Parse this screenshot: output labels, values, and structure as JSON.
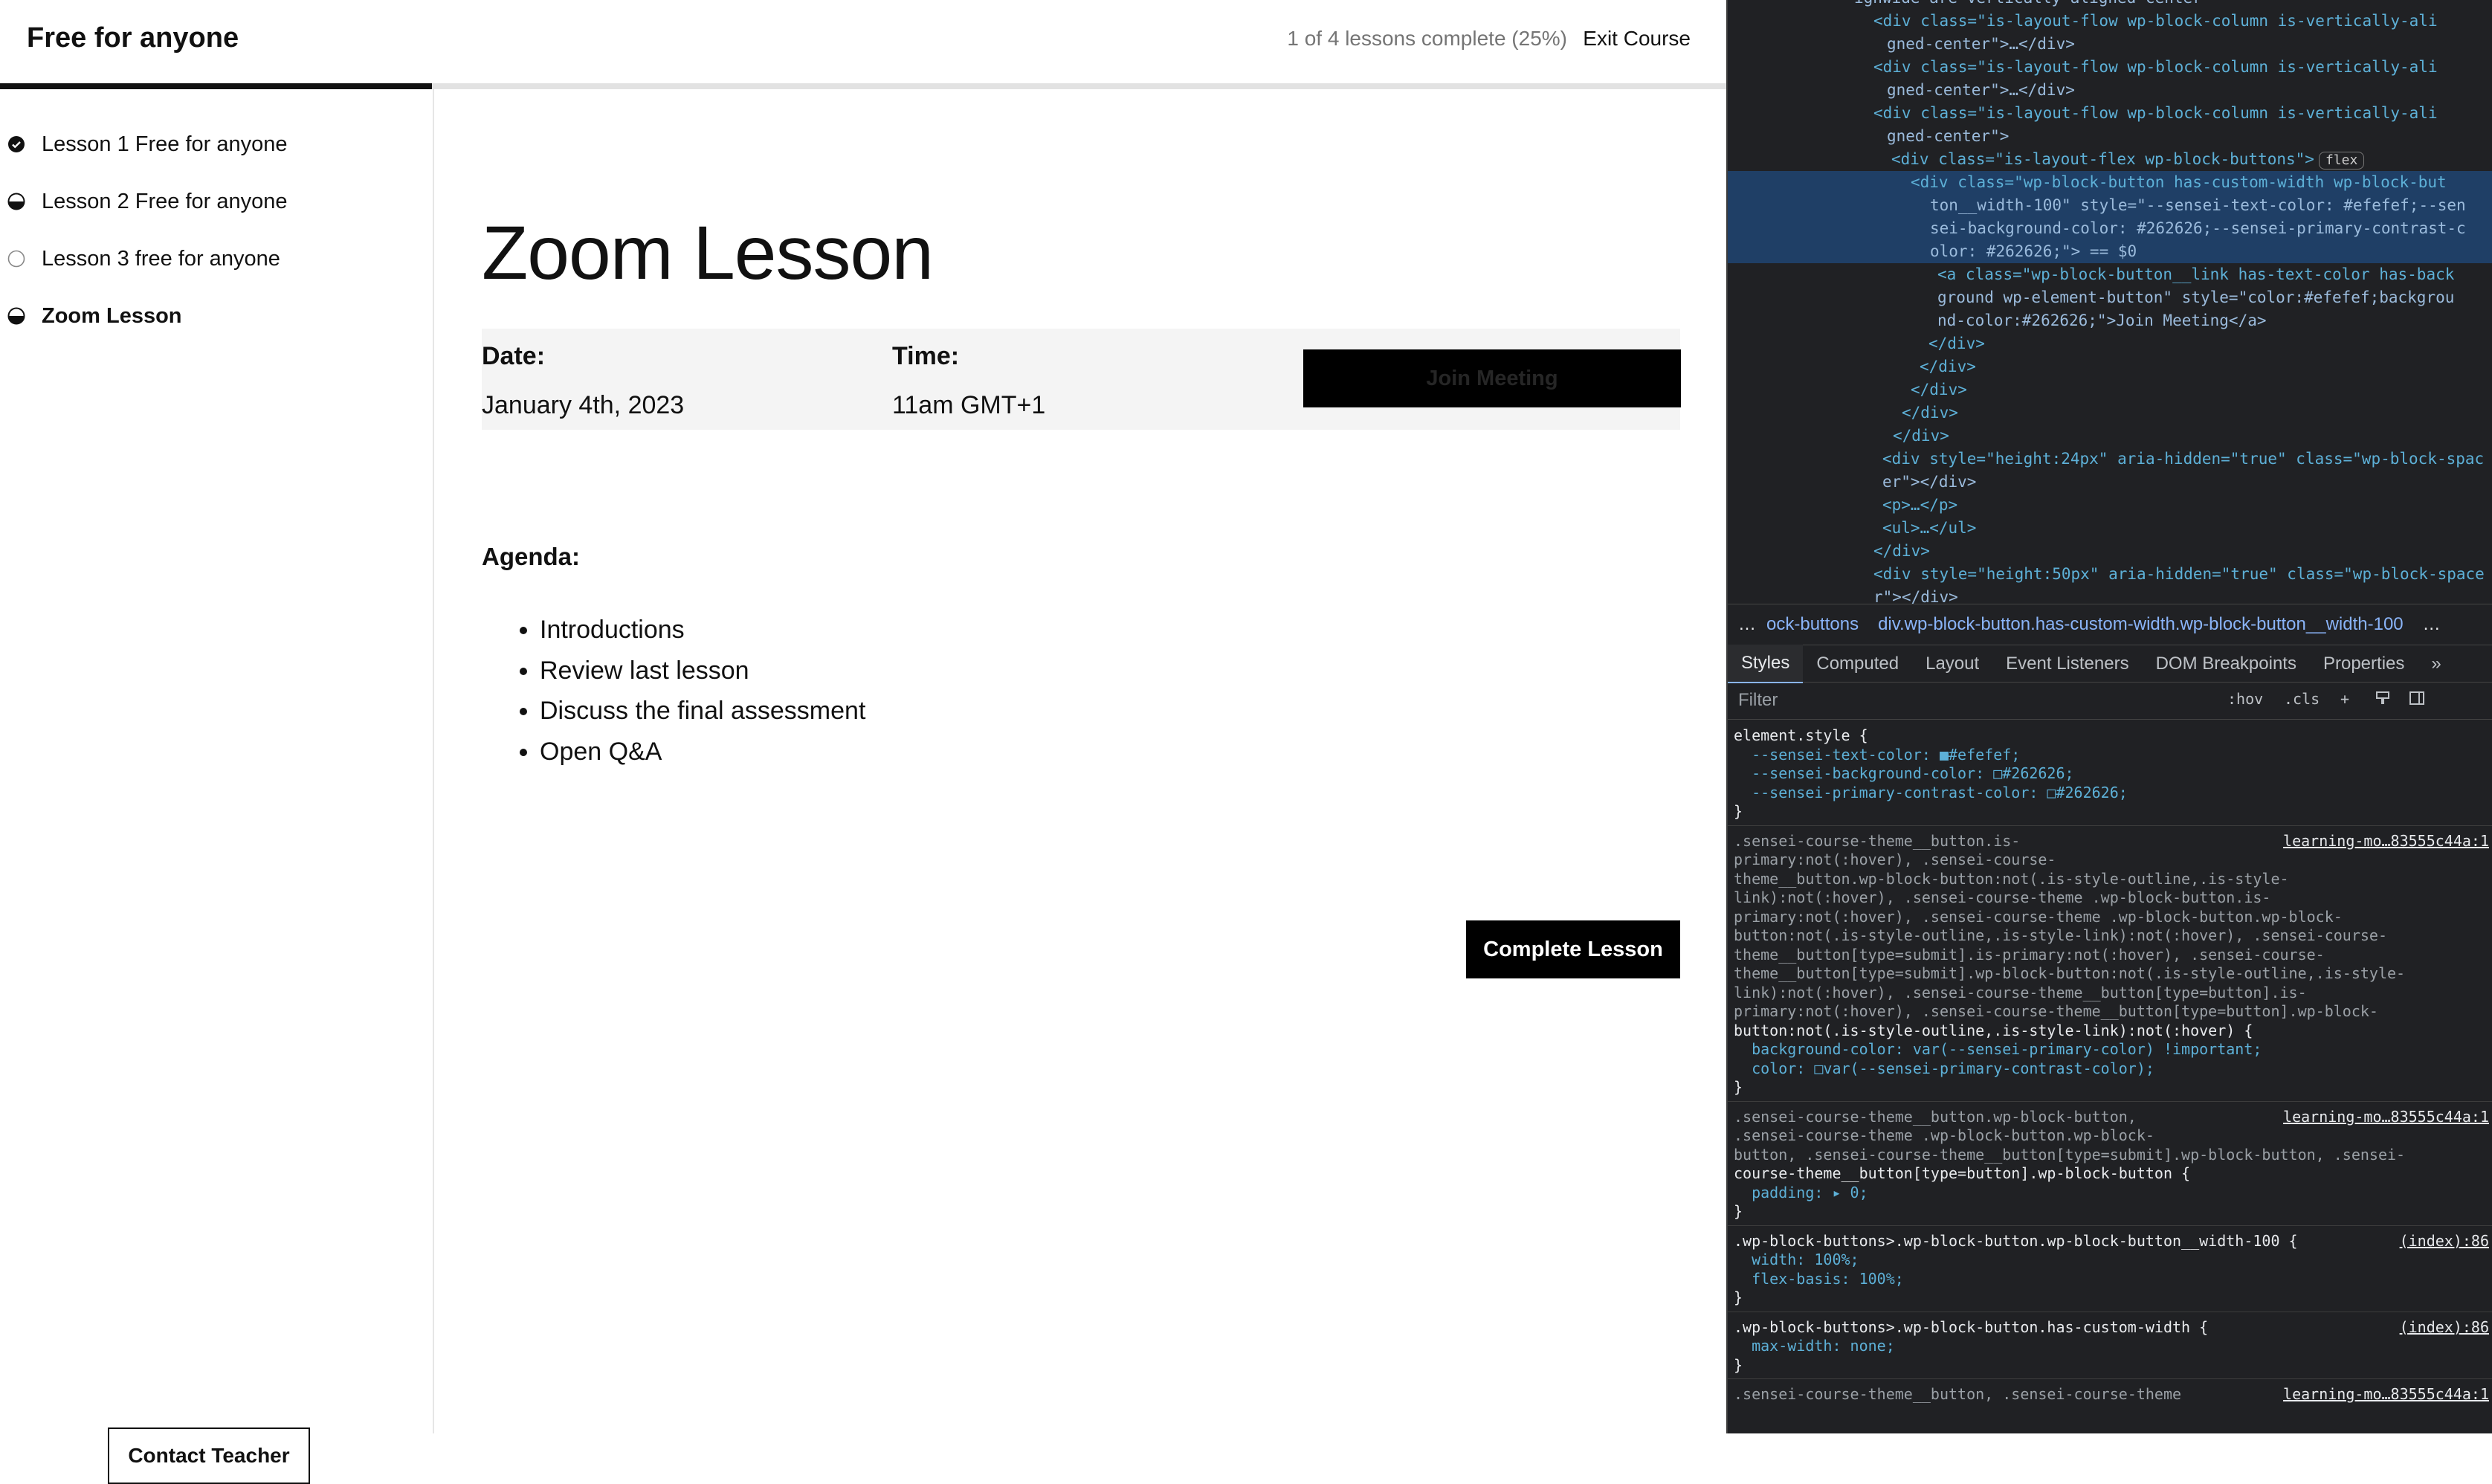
{
  "header": {
    "course_title": "Free for anyone",
    "progress_text": "1 of 4 lessons complete (25%)",
    "progress_fraction": 0.25,
    "exit_label": "Exit Course"
  },
  "sidebar": {
    "lessons": [
      {
        "label": "Lesson 1 Free for anyone",
        "status": "complete"
      },
      {
        "label": "Lesson 2 Free for anyone",
        "status": "in-progress"
      },
      {
        "label": "Lesson 3 free for anyone",
        "status": "not-started"
      },
      {
        "label": "Zoom Lesson",
        "status": "in-progress"
      }
    ],
    "contact_label": "Contact Teacher"
  },
  "lesson": {
    "title": "Zoom Lesson",
    "date_label": "Date:",
    "date_value": "January 4th, 2023",
    "time_label": "Time:",
    "time_value": "11am GMT+1",
    "join_label": "Join Meeting",
    "agenda_title": "Agenda:",
    "agenda_items": [
      "Introductions",
      "Review last lesson",
      "Discuss the final assessment",
      "Open Q&A"
    ],
    "complete_label": "Complete Lesson"
  },
  "devtools": {
    "dom_lines": [
      "ighwide are vertically aligned center",
      "<div class=\"is-layout-flow wp-block-column is-vertically-ali",
      "gned-center\">…</div>",
      "<div class=\"is-layout-flow wp-block-column is-vertically-ali",
      "gned-center\">…</div>",
      "<div class=\"is-layout-flow wp-block-column is-vertically-ali",
      "gned-center\">",
      "<div class=\"is-layout-flex wp-block-buttons\">",
      "<div class=\"wp-block-button has-custom-width wp-block-but",
      "ton__width-100\" style=\"--sensei-text-color: #efefef;--sen",
      "sei-background-color: #262626;--sensei-primary-contrast-c",
      "olor: #262626;\"> == $0",
      "<a class=\"wp-block-button__link has-text-color has-back",
      "ground wp-element-button\" style=\"color:#efefef;backgrou",
      "nd-color:#262626;\">Join Meeting</a>",
      "</div>",
      "</div>",
      "</div>",
      "</div>",
      "</div>",
      "<div style=\"height:24px\" aria-hidden=\"true\" class=\"wp-block-spac",
      "er\"></div>",
      "<p>…</p>",
      "<ul>…</ul>",
      "</div>",
      "<div style=\"height:50px\" aria-hidden=\"true\" class=\"wp-block-space",
      "r\"></div>"
    ],
    "flex_badge": "flex",
    "breadcrumb": [
      "…",
      "ock-buttons",
      "div.wp-block-button.has-custom-width.wp-block-button__width-100",
      "…"
    ],
    "tabs": [
      "Styles",
      "Computed",
      "Layout",
      "Event Listeners",
      "DOM Breakpoints",
      "Properties",
      "»"
    ],
    "filter_placeholder": "Filter",
    "filter_controls": [
      ":hov",
      ".cls",
      "+"
    ],
    "style_lines": [
      "element.style {",
      "  --sensei-text-color: ■#efefef;",
      "  --sensei-background-color: □#262626;",
      "  --sensei-primary-contrast-color: □#262626;",
      "}",
      ".sensei-course-theme__button.is-",
      "primary:not(:hover), .sensei-course-",
      "theme__button.wp-block-button:not(.is-style-outline,.is-style-",
      "link):not(:hover), .sensei-course-theme .wp-block-button.is-",
      "primary:not(:hover), .sensei-course-theme .wp-block-button.wp-block-",
      "button:not(.is-style-outline,.is-style-link):not(:hover), .sensei-course-",
      "theme__button[type=submit].is-primary:not(:hover), .sensei-course-",
      "theme__button[type=submit].wp-block-button:not(.is-style-outline,.is-style-",
      "link):not(:hover), .sensei-course-theme__button[type=button].is-",
      "primary:not(:hover), .sensei-course-theme__button[type=button].wp-block-",
      "button:not(.is-style-outline,.is-style-link):not(:hover) {",
      "  background-color: var(--sensei-primary-color) !important;",
      "  color: □var(--sensei-primary-contrast-color);",
      "}",
      ".sensei-course-theme__button.wp-block-button,",
      ".sensei-course-theme .wp-block-button.wp-block-",
      "button, .sensei-course-theme__button[type=submit].wp-block-button, .sensei-",
      "course-theme__button[type=button].wp-block-button {",
      "  padding: ▸ 0;",
      "}",
      ".wp-block-buttons>.wp-block-button.wp-block-button__width-100 {",
      "  width: 100%;",
      "  flex-basis: 100%;",
      "}",
      ".wp-block-buttons>.wp-block-button.has-custom-width {",
      "  max-width: none;",
      "}",
      ".sensei-course-theme__button, .sensei-course-theme"
    ],
    "sources": [
      "learning-mo…83555c44a:1",
      "learning-mo…83555c44a:1",
      "(index):86",
      "(index):86",
      "learning-mo…83555c44a:1"
    ]
  },
  "colors": {
    "accent": "#111111",
    "devtools_bg": "#202124",
    "selected_row": "#1f3f66",
    "meeting_box_bg": "#f4f4f4"
  }
}
